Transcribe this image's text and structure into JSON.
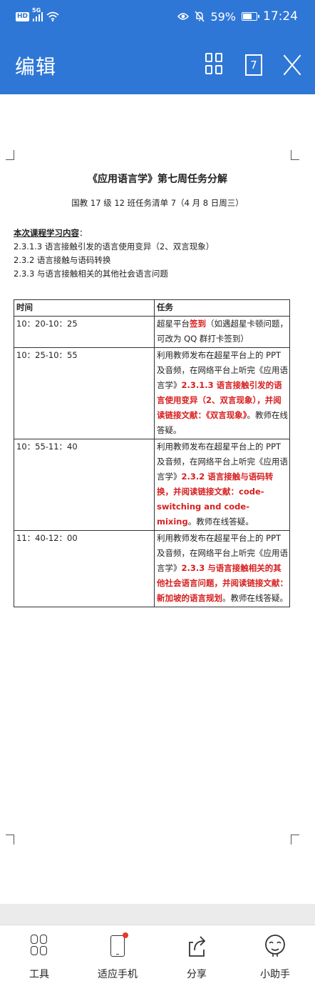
{
  "status_bar": {
    "network_badge": "HD",
    "network_type": "5G",
    "battery_percent": "59%",
    "battery_level": 0.59,
    "time": "17:24",
    "icons": [
      "hd-icon",
      "signal-icon",
      "wifi-icon",
      "eye-care-icon",
      "mute-icon",
      "battery-icon"
    ]
  },
  "header": {
    "title": "编辑",
    "page_count": "7",
    "background": "#2f77d6"
  },
  "document": {
    "title": "《应用语言学》第七周任务分解",
    "subtitle": "国教 17 级 12 班任务清单 7（4 月 8 日周三）",
    "section_heading": "本次课程学习内容",
    "section_heading_suffix": "：",
    "items": [
      "2.3.1.3  语言接触引发的语言使用变异（2、双言现象）",
      "2.3.2 语言接触与语码转换",
      "2.3.3 与语言接触相关的其他社会语言问题"
    ],
    "table": {
      "headers": [
        "时间",
        "任务"
      ],
      "rows": [
        {
          "time": "10：20-10：25",
          "task": [
            {
              "text": "超星平台",
              "red": false
            },
            {
              "text": "签到",
              "red": true
            },
            {
              "text": "（如遇超星卡顿问题，可改为 QQ 群打卡签到）",
              "red": false
            }
          ]
        },
        {
          "time": "10：25-10：55",
          "task": [
            {
              "text": "利用教师发布在超星平台上的 PPT 及音频，在网络平台上听完《应用语言学》",
              "red": false
            },
            {
              "text": "2.3.1.3 语言接触引发的语言使用变异（2、双言现象），并阅读链接文献：《双言现象》",
              "red": true
            },
            {
              "text": "。教师在线答疑。",
              "red": false
            }
          ]
        },
        {
          "time": "10：55-11：40",
          "task": [
            {
              "text": "利用教师发布在超星平台上的 PPT 及音频，在网络平台上听完《应用语言学》",
              "red": false
            },
            {
              "text": "2.3.2 语言接触与语码转换，并阅读链接文献：code-switching and code-mixing",
              "red": true
            },
            {
              "text": "。教师在线答疑。",
              "red": false
            }
          ]
        },
        {
          "time": "11：40-12：00",
          "task": [
            {
              "text": "利用教师发布在超星平台上的 PPT 及音频，在网络平台上听完《应用语言学》",
              "red": false
            },
            {
              "text": "2.3.3 与语言接触相关的其他社会语言问题，并阅读链接文献：新加坡的语言规划",
              "red": true
            },
            {
              "text": "。教师在线答疑。",
              "red": false
            }
          ]
        }
      ]
    },
    "accent_red": "#d71f1f"
  },
  "bottom_nav": [
    {
      "label": "工具",
      "icon": "tools-icon"
    },
    {
      "label": "适应手机",
      "icon": "fit-phone-icon"
    },
    {
      "label": "分享",
      "icon": "share-icon"
    },
    {
      "label": "小助手",
      "icon": "assistant-icon"
    }
  ]
}
